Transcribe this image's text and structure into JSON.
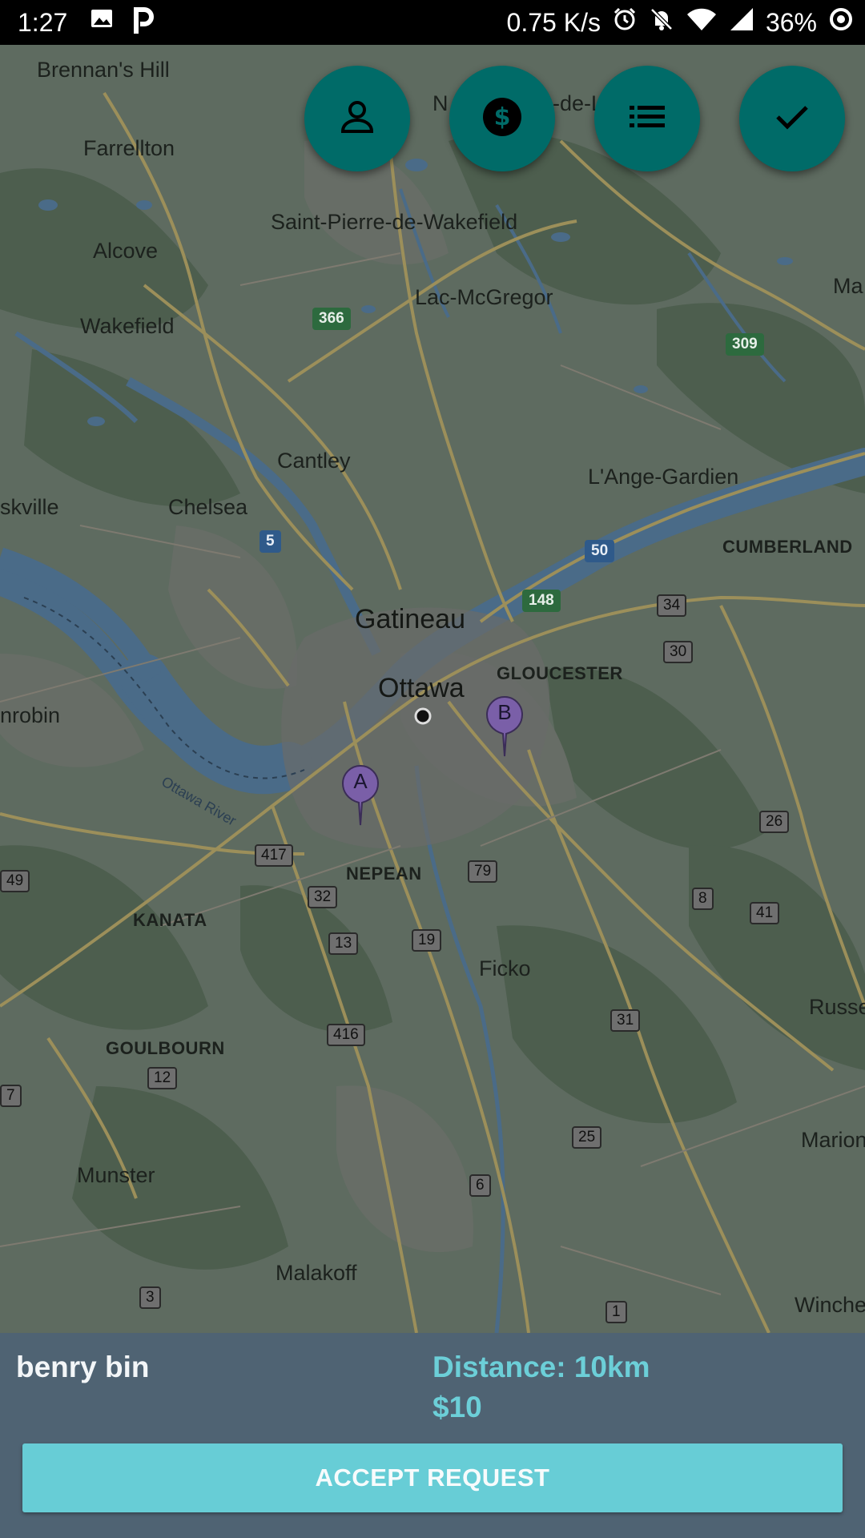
{
  "status_bar": {
    "time": "1:27",
    "network_speed": "0.75 K/s",
    "battery": "36%",
    "icons": [
      "image-icon",
      "parking-app-icon",
      "alarm-icon",
      "notifications-off-icon",
      "wifi-icon",
      "signal-icon",
      "battery-icon"
    ]
  },
  "map": {
    "places": [
      "Brennan's Hill",
      "Farrellton",
      "Saint-Pierre-de-Wakefield",
      "Alcove",
      "Lac-McGregor",
      "Wakefield",
      "Cantley",
      "L'Ange-Gardien",
      "Chelsea",
      "CUMBERLAND",
      "Gatineau",
      "Ottawa",
      "GLOUCESTER",
      "NEPEAN",
      "KANATA",
      "Ficko",
      "GOULBOURN",
      "Munster",
      "Malakoff",
      "Marion",
      "Russe",
      "Winche",
      "nrobin",
      "skville",
      "Ma",
      "N",
      "-de-L",
      "Ottawa River"
    ],
    "route_numbers": [
      "366",
      "309",
      "5",
      "50",
      "148",
      "34",
      "30",
      "26",
      "417",
      "79",
      "32",
      "8",
      "41",
      "13",
      "19",
      "31",
      "416",
      "12",
      "25",
      "6",
      "3",
      "1",
      "49",
      "7"
    ],
    "markers": [
      {
        "label": "A",
        "color": "#7a5fa8"
      },
      {
        "label": "B",
        "color": "#7a5fa8"
      }
    ]
  },
  "fabs": [
    {
      "icon": "person-icon"
    },
    {
      "icon": "dollar-icon"
    },
    {
      "icon": "list-icon"
    },
    {
      "icon": "check-icon"
    }
  ],
  "request": {
    "rider_name": "benry bin",
    "distance": "Distance: 10km",
    "price": "$10",
    "accept_label": "ACCEPT REQUEST"
  },
  "colors": {
    "fab": "#006b68",
    "panel": "#4f6373",
    "accent": "#6ccfd8",
    "button": "#67cdd6"
  }
}
